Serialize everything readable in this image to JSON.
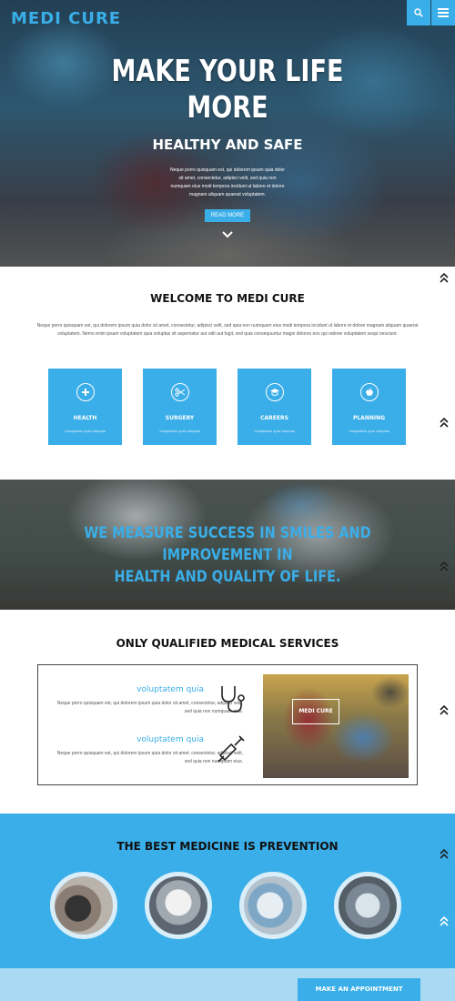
{
  "header": {
    "logo": "MEDI CURE",
    "search_icon": "search-icon",
    "menu_icon": "hamburger-menu-icon"
  },
  "hero": {
    "title_line1": "MAKE YOUR LIFE",
    "title_line2": "MORE",
    "subtitle": "HEALTHY AND SAFE",
    "text": "Neque porro quisquam est, qui dolorem ipsum quia dolor sit amet, consectetur, adipisci velit, sed quia non numquam eius modi tempora incidunt ut labore et dolore magnam aliquam quaerat voluptatem.",
    "button": "READ MORE"
  },
  "welcome": {
    "title": "WELCOME TO MEDI CURE",
    "text": "Neque porro quisquam est, qui dolorem ipsum quia dolor sit amet, consectetur, adipisci velit, sed quia non numquam eius modi tempora incidunt ut labore et dolore magnam aliquam quaerat voluptatem. Nemo enim ipsam voluptatem quia voluptas sit aspernatur aut odit aut fugit, sed quia consequuntur magni dolores eos qui ratione voluptatem sequi nesciunt.",
    "features": [
      {
        "label": "HEALTH",
        "desc": "Voluptatem quia voluptas",
        "icon": "plus-icon"
      },
      {
        "label": "SURGERY",
        "desc": "Voluptatem quia voluptas",
        "icon": "scissors-icon"
      },
      {
        "label": "CAREERS",
        "desc": "Voluptatem quia voluptas",
        "icon": "graduation-cap-icon"
      },
      {
        "label": "PLANNING",
        "desc": "Voluptatem quia voluptas",
        "icon": "apple-icon"
      }
    ]
  },
  "quote": {
    "line1": "WE MEASURE SUCCESS IN SMILES AND IMPROVEMENT IN",
    "line2": "HEALTH AND QUALITY OF LIFE."
  },
  "services": {
    "title": "ONLY QUALIFIED MEDICAL SERVICES",
    "items": [
      {
        "title": "voluptatem quia",
        "text": "Neque porro quisquam est, qui dolorem ipsum quia dolor sit amet, consectetur, adipisci velit, sed quia non numquam eius.",
        "icon": "stethoscope-icon"
      },
      {
        "title": "voluptatem quia",
        "text": "Neque porro quisquam est, qui dolorem ipsum quia dolor sit amet, consectetur, adipisci velit, sed quia non numquam eius.",
        "icon": "syringe-icon"
      }
    ],
    "photo_label": "MEDI CURE"
  },
  "prevention": {
    "title": "THE BEST MEDICINE IS PREVENTION"
  },
  "appointment": {
    "button": "MAKE AN APPOINTMENT"
  },
  "colors": {
    "accent": "#3aaee8",
    "light_accent": "#a9d9f3",
    "text_dark": "#111111"
  }
}
